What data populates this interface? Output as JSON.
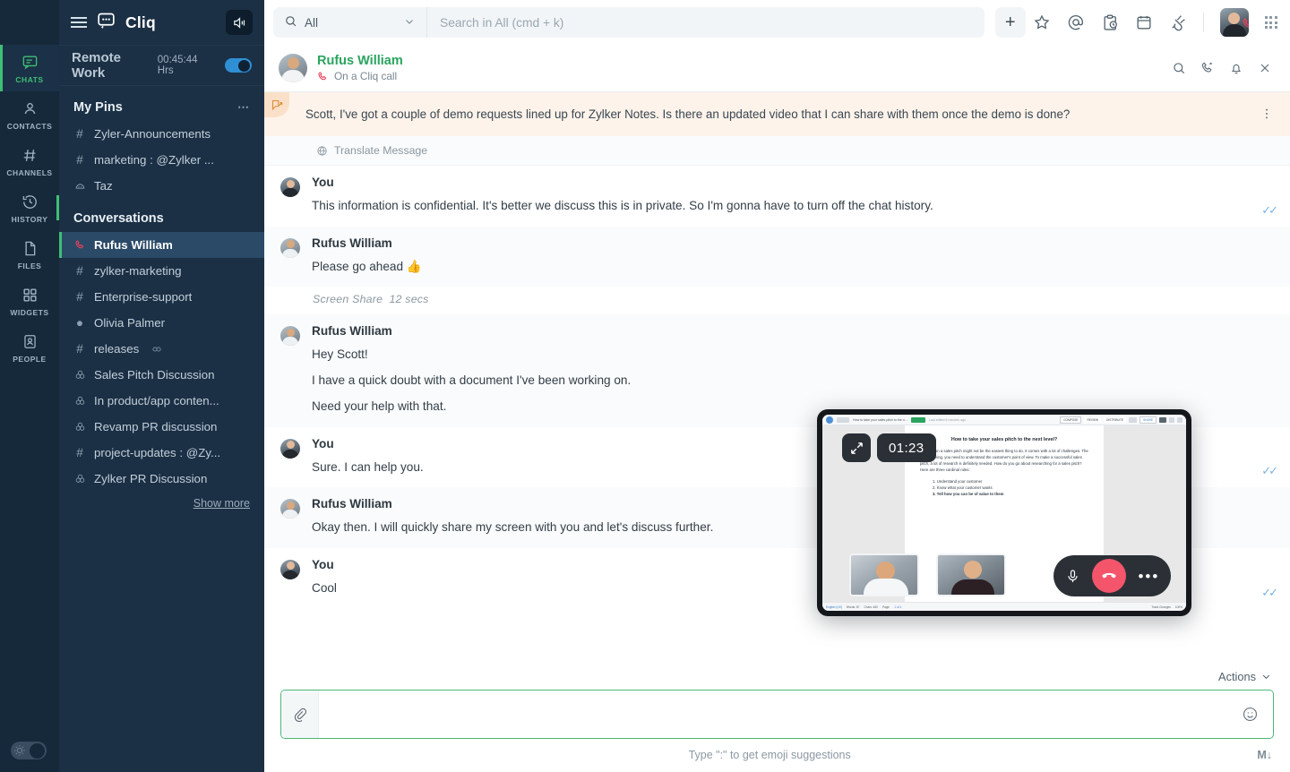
{
  "app": {
    "brand_name": "Cliq",
    "logo_icon": "chat-bubble-icon",
    "menu_icon": "hamburger-menu-icon",
    "speaker_icon": "speaker-icon"
  },
  "status_bar": {
    "name": "Remote Work",
    "time": "00:45:44 Hrs",
    "toggle_on": true,
    "toggle_color": "#2f8fd4"
  },
  "rail": {
    "items": [
      {
        "label": "CHATS",
        "icon": "chat-icon",
        "active": true
      },
      {
        "label": "CONTACTS",
        "icon": "person-icon",
        "active": false
      },
      {
        "label": "CHANNELS",
        "icon": "hash-icon",
        "active": false
      },
      {
        "label": "HISTORY",
        "icon": "history-clock-icon",
        "active": false
      },
      {
        "label": "FILES",
        "icon": "file-icon",
        "active": false
      },
      {
        "label": "WIDGETS",
        "icon": "grid-squares-icon",
        "active": false
      },
      {
        "label": "PEOPLE",
        "icon": "people-card-icon",
        "active": false
      }
    ],
    "theme_toggle_icon": "sun-icon",
    "accent_color": "#3fbf74"
  },
  "sidebar": {
    "pins_title": "My Pins",
    "pins_more_icon": "ellipsis-icon",
    "pins": [
      {
        "label": "Zyler-Announcements",
        "icon": "hash-icon"
      },
      {
        "label": "marketing : @Zylker ...",
        "icon": "hash-icon"
      },
      {
        "label": "Taz",
        "icon": "bot-icon"
      }
    ],
    "conversations_title": "Conversations",
    "conversations": [
      {
        "label": "Rufus William",
        "icon": "call-icon",
        "active": true
      },
      {
        "label": "zylker-marketing",
        "icon": "hash-icon",
        "active": false
      },
      {
        "label": "Enterprise-support",
        "icon": "hash-icon",
        "active": false
      },
      {
        "label": "Olivia Palmer",
        "icon": "status-dot-icon",
        "active": false
      },
      {
        "label": "releases",
        "icon": "hash-icon",
        "active": false,
        "trail_icon": "mute-icon"
      },
      {
        "label": "Sales Pitch Discussion",
        "icon": "group-icon",
        "active": false
      },
      {
        "label": "In product/app conten...",
        "icon": "group-icon",
        "active": false
      },
      {
        "label": "Revamp PR discussion",
        "icon": "group-icon",
        "active": false
      },
      {
        "label": "project-updates : @Zy...",
        "icon": "hash-icon",
        "active": false
      },
      {
        "label": "Zylker PR Discussion",
        "icon": "group-icon",
        "active": false
      }
    ],
    "show_more": "Show more"
  },
  "topbar": {
    "scope_label": "All",
    "scope_icon": "search-icon",
    "scope_chevron": "chevron-down-icon",
    "search_placeholder": "Search in All (cmd + k)",
    "search_value": "",
    "add_button": "+",
    "icons": [
      {
        "name": "star-icon"
      },
      {
        "name": "mention-at-icon"
      },
      {
        "name": "reminder-clipboard-icon"
      },
      {
        "name": "calendar-icon"
      },
      {
        "name": "plug-integrations-icon"
      }
    ],
    "avatar_name": "avatar",
    "avatar_call_badge": "call-badge-icon",
    "apps_grid_icon": "apps-grid-icon"
  },
  "chat_header": {
    "name": "Rufus William",
    "name_color": "#2aa45f",
    "status": "On a Cliq call",
    "status_icon": "call-icon",
    "actions": [
      {
        "name": "search-in-chat-icon"
      },
      {
        "name": "call-icon"
      },
      {
        "name": "bell-notification-icon"
      },
      {
        "name": "close-icon"
      }
    ]
  },
  "pinned_message": {
    "icon": "pin-message-icon",
    "text": "Scott, I've got a couple of demo requests lined up for Zylker Notes. Is there an updated video that I can share with them once the demo is done?",
    "more_icon": "vertical-ellipsis-icon",
    "background": "#fdf3ea"
  },
  "messages": {
    "translate_label": "Translate Message",
    "translate_icon": "translate-globe-icon",
    "screen_share_label": "Screen Share",
    "screen_share_duration": "12 secs",
    "items": [
      {
        "author": "You",
        "avatar": "you",
        "lines": [
          "This information is confidential. It's better we discuss this is in private. So I'm gonna have to turn off the chat history."
        ],
        "read_receipt": true
      },
      {
        "author": "Rufus William",
        "avatar": "rufus",
        "lines": [
          "Please go ahead  👍"
        ],
        "read_receipt": false
      },
      {
        "author": "Rufus William",
        "avatar": "rufus",
        "lines": [
          "Hey Scott!",
          "I have a quick doubt with a document I've been working on.",
          "Need your help with that."
        ],
        "read_receipt": false
      },
      {
        "author": "You",
        "avatar": "you",
        "lines": [
          "Sure. I can help you."
        ],
        "read_receipt": true
      },
      {
        "author": "Rufus William",
        "avatar": "rufus",
        "lines": [
          "Okay then. I will quickly share my screen with you and let's discuss further."
        ],
        "read_receipt": false
      },
      {
        "author": "You",
        "avatar": "you",
        "lines": [
          "Cool"
        ],
        "read_receipt": true
      }
    ]
  },
  "composer": {
    "actions_label": "Actions",
    "actions_chevron": "chevron-down-icon",
    "attach_icon": "paperclip-icon",
    "emoji_icon": "emoji-smiley-icon",
    "input_value": "",
    "input_placeholder": "",
    "hint": "Type \":\" to get emoji suggestions",
    "markdown_indicator": "M↓",
    "border_color": "#4cb87b"
  },
  "call_overlay": {
    "timer": "01:23",
    "expand_icon": "expand-fullscreen-icon",
    "mic_icon": "microphone-icon",
    "end_call_icon": "end-call-icon",
    "more_icon": "more-options-icon",
    "end_call_color": "#f4556a",
    "participants": [
      {
        "name": "participant-thumbnail-1"
      },
      {
        "name": "participant-thumbnail-2"
      }
    ],
    "shared_document": {
      "toolbar_title": "How to take your sales pitch to the n...",
      "toolbar_badge": "MOVE",
      "toolbar_saved": "Last edited 8 minutes ago",
      "toolbar_buttons": [
        "COMPOSE",
        "REVIEW",
        "DISTRIBUTE",
        "SHARE"
      ],
      "heading": "How to take your sales pitch to the next level?",
      "paragraph": "Working on a sales pitch might not be the easiest thing to do. It comes with a lot of challenges. The reason being, you need to understand the customer's point of view. To make a successful sales pitch, a lot of research is definitely needed. How do you go about researching for a sales pitch? Here are three cardinal rules:",
      "list": [
        "1. Understand your customer",
        "2. Know what your customer wants",
        "3. Tell how you can be of value to them"
      ],
      "status_left": [
        "English (US)",
        "Words: 87",
        "Chars: 460",
        "Page:",
        "1 of 1"
      ],
      "status_right": [
        "Track Changes",
        "100%"
      ]
    }
  }
}
